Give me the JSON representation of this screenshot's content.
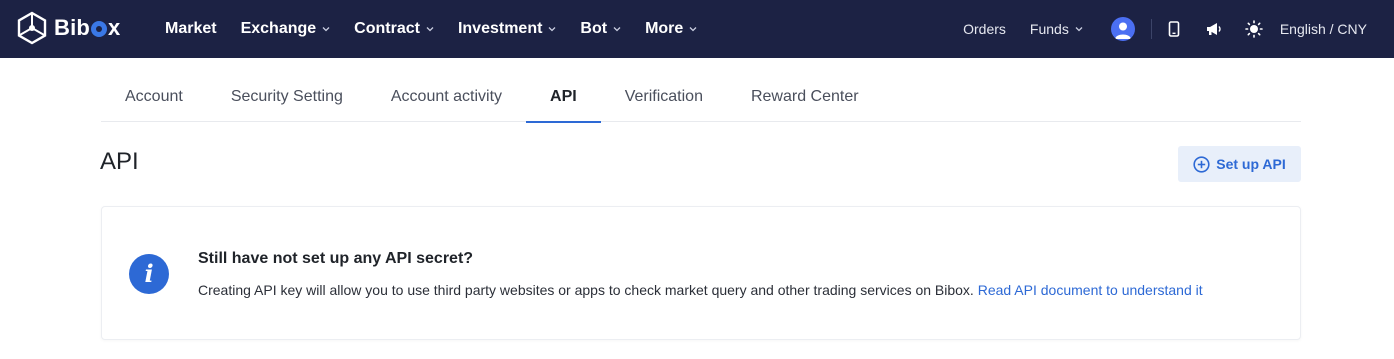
{
  "brand": {
    "name_prefix": "Bib",
    "name_suffix": "x",
    "logo_icon": "hexagon-network-icon",
    "nav_background": "#1c2244",
    "accent": "#2d69d5"
  },
  "nav": {
    "items": [
      {
        "label": "Market",
        "has_dropdown": false
      },
      {
        "label": "Exchange",
        "has_dropdown": true
      },
      {
        "label": "Contract",
        "has_dropdown": true
      },
      {
        "label": "Investment",
        "has_dropdown": true
      },
      {
        "label": "Bot",
        "has_dropdown": true
      },
      {
        "label": "More",
        "has_dropdown": true
      }
    ],
    "right": {
      "orders": "Orders",
      "funds": "Funds",
      "avatar_icon": "user-avatar-icon",
      "mobile_icon": "mobile-phone-icon",
      "announce_icon": "megaphone-icon",
      "theme_icon": "sun-icon",
      "language": "English / CNY"
    }
  },
  "tabs": [
    {
      "label": "Account",
      "active": false
    },
    {
      "label": "Security Setting",
      "active": false
    },
    {
      "label": "Account activity",
      "active": false
    },
    {
      "label": "API",
      "active": true
    },
    {
      "label": "Verification",
      "active": false
    },
    {
      "label": "Reward Center",
      "active": false
    }
  ],
  "page": {
    "title": "API",
    "setup_button": "Set up API",
    "setup_icon": "plus-circle-icon"
  },
  "notice": {
    "icon": "info-icon",
    "title": "Still have not set up any API secret?",
    "description": "Creating API key will allow you to use third party websites or apps to check market query and other trading services on Bibox.",
    "link": "Read API document to understand it"
  }
}
